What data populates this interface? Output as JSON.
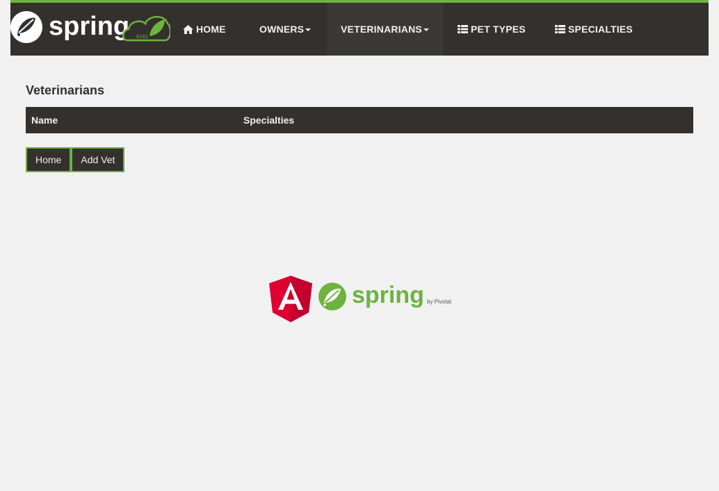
{
  "brand": {
    "logo_text": "spring",
    "badge_text": "0101"
  },
  "nav": {
    "items": [
      {
        "label": "HOME",
        "icon": "home-icon"
      },
      {
        "label": "OWNERS",
        "icon": "caret-down-icon"
      },
      {
        "label": "VETERINARIANS",
        "icon": "caret-down-icon"
      },
      {
        "label": "PET TYPES",
        "icon": "list-icon"
      },
      {
        "label": "SPECIALTIES",
        "icon": "list-icon"
      }
    ]
  },
  "page": {
    "title": "Veterinarians"
  },
  "table": {
    "columns": [
      "Name",
      "Specialties"
    ]
  },
  "buttons": {
    "home": "Home",
    "add_vet": "Add Vet"
  },
  "footer": {
    "spring_text": "spring",
    "pivotal_text": "by Pivotal."
  },
  "colors": {
    "brand_green": "#6db33f",
    "dark": "#34302d",
    "angular_red": "#dd0031",
    "background": "#f1f1f1"
  }
}
